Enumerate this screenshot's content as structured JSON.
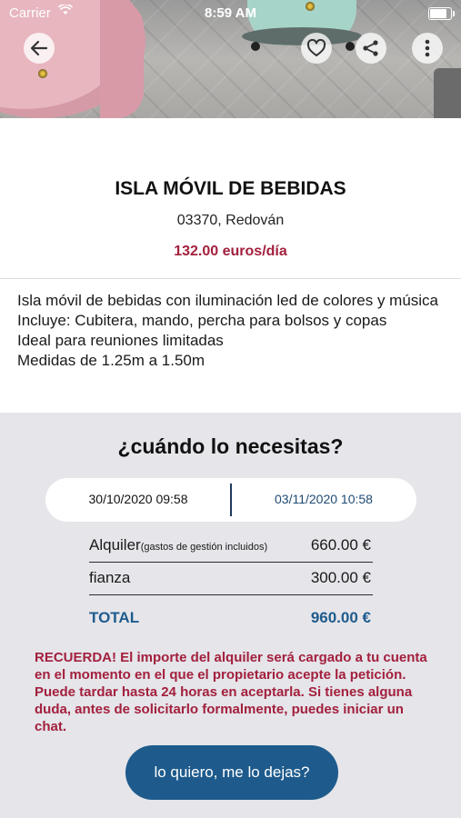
{
  "status_bar": {
    "carrier": "Carrier",
    "time": "8:59 AM"
  },
  "icons": {
    "back": "arrow-left-icon",
    "favorite": "heart-icon",
    "share": "share-icon",
    "more": "more-vertical-icon",
    "wifi": "wifi-icon",
    "battery": "battery-icon"
  },
  "listing": {
    "title": "ISLA MÓVIL DE BEBIDAS",
    "location": "03370, Redován",
    "price": "132.00 euros/día",
    "description": [
      "Isla móvil de bebidas con iluminación led de colores y música",
      "Incluye: Cubitera, mando, percha para bolsos y copas",
      "Ideal para reuniones limitadas",
      "Medidas de 1.25m a 1.50m"
    ]
  },
  "booking": {
    "question": "¿cuándo lo necesitas?",
    "start_date": "30/10/2020 09:58",
    "end_date": "03/11/2020 10:58",
    "rent_label": "Alquiler",
    "rent_note": "(gastos de gestión incluidos)",
    "rent_amount": "660.00 €",
    "bond_label": "fianza",
    "bond_amount": "300.00 €",
    "total_label": "TOTAL",
    "total_amount": "960.00 €",
    "notice": "RECUERDA! El importe del alquiler será cargado a tu cuenta en el momento en el que el propietario acepte la petición. Puede tardar hasta 24 horas en aceptarla. Si tienes alguna duda, antes de solicitarlo formalmente, puedes iniciar un chat.",
    "cta_label": "lo quiero, me lo dejas?"
  },
  "colors": {
    "accent_blue": "#1e5b8c",
    "price_red": "#a3203d",
    "panel_bg": "#e5e5ea"
  }
}
